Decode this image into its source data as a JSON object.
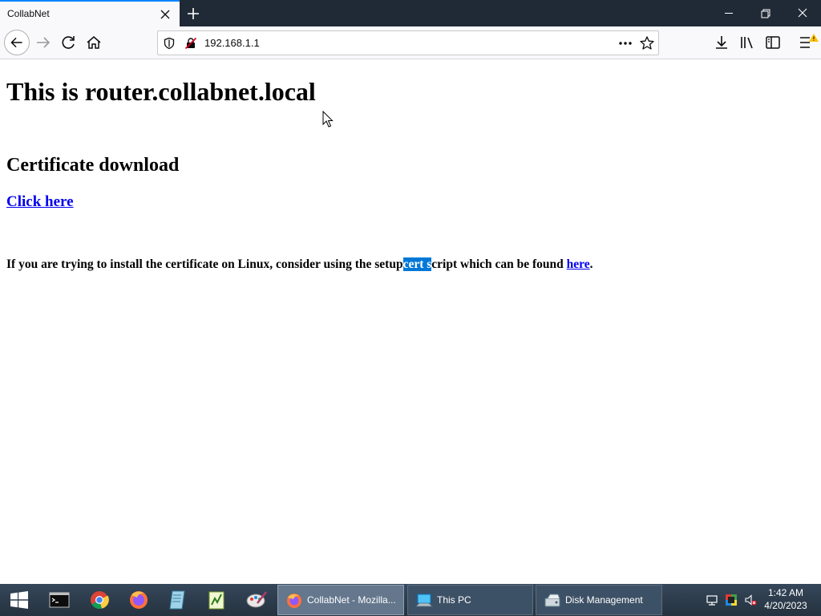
{
  "browser": {
    "tab_title": "CollabNet",
    "url": "192.168.1.1"
  },
  "page": {
    "heading": "This is router.collabnet.local",
    "subheading": "Certificate download",
    "link_text": "Click here",
    "info_prefix": "If you are trying to install the certificate on Linux, consider using the setup",
    "info_selected": "cert s",
    "info_middle": "cript which can be found ",
    "info_link": "here",
    "info_suffix": "."
  },
  "taskbar": {
    "tasks": [
      {
        "label": "CollabNet - Mozilla..."
      },
      {
        "label": "This PC"
      },
      {
        "label": "Disk Management"
      }
    ],
    "clock_time": "1:42 AM",
    "clock_date": "4/20/2023"
  },
  "colors": {
    "accent": "#0a84ff",
    "link": "#0000ee",
    "selection": "#0078d7",
    "titlebar": "#202a36"
  }
}
